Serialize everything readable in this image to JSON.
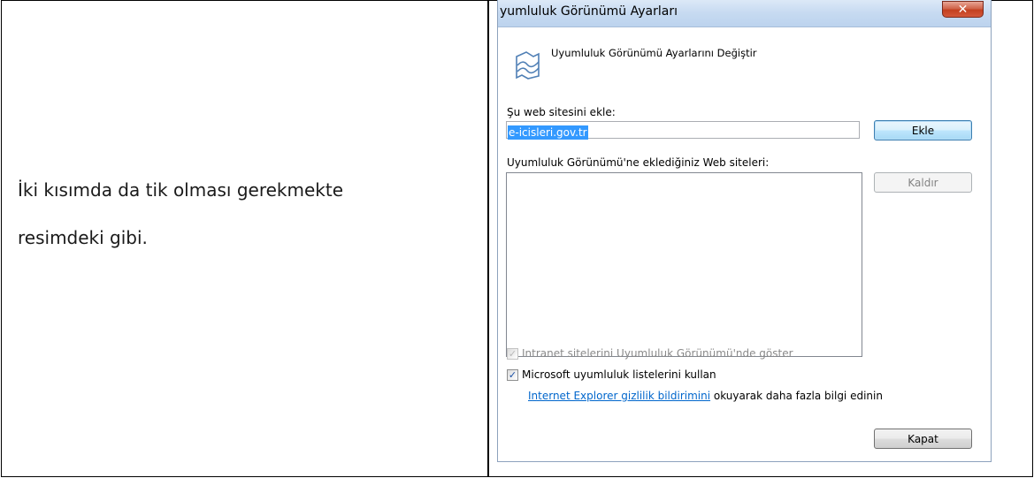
{
  "document": {
    "note_lines": [
      "İki kısımda da tik olması gerekmekte",
      "resimdeki gibi."
    ]
  },
  "dialog": {
    "title": "yumluluk Görünümü Ayarları",
    "close_symbol": "✕",
    "header_icon": "compat-view-icon",
    "header_text": "Uyumluluk Görünümü Ayarlarını Değiştir",
    "add_label": "Şu web sitesini ekle:",
    "add_input_value": "e-icisleri.gov.tr",
    "add_button": "Ekle",
    "list_label": "Uyumluluk Görünümü'ne eklediğiniz Web siteleri:",
    "sites": [],
    "remove_button": "Kaldır",
    "intranet_checkbox": {
      "label": "Intranet sitelerini Uyumluluk Görünümü'nde göster",
      "checked": true,
      "enabled": false
    },
    "ms_lists_checkbox": {
      "label": "Microsoft uyumluluk listelerini kullan",
      "checked": true,
      "enabled": true
    },
    "privacy_link": "Internet Explorer gizlilik bildirimini",
    "privacy_suffix": " okuyarak daha fazla bilgi edinin",
    "close_button": "Kapat",
    "colors": {
      "titlebar": "#c6daf1",
      "selection": "#3399ff",
      "link": "#0066cc",
      "close_red": "#c34020"
    }
  }
}
